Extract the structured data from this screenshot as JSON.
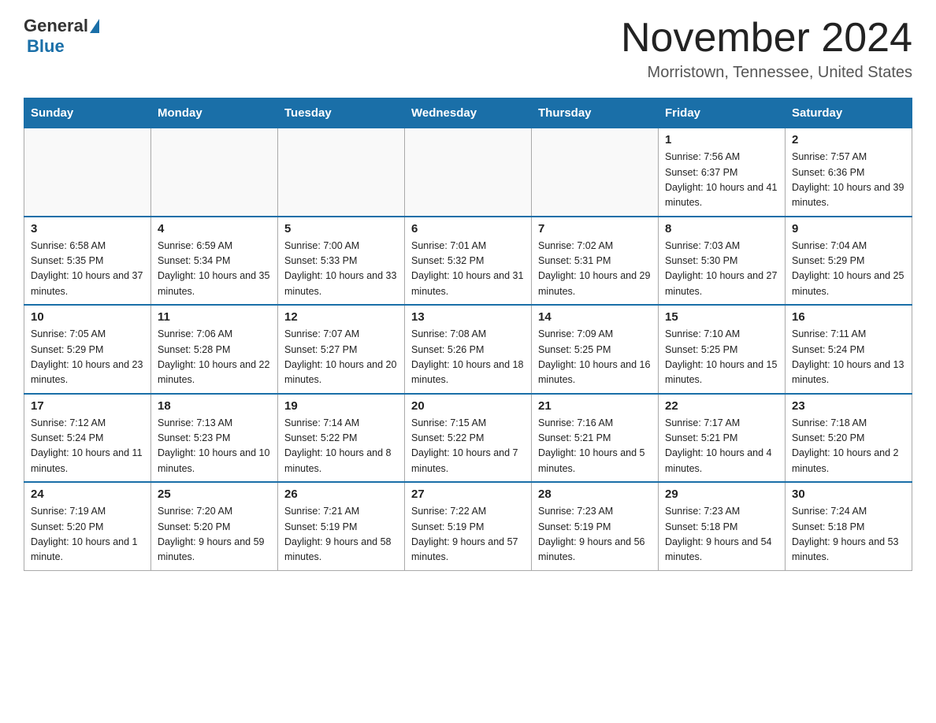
{
  "logo": {
    "general": "General",
    "blue": "Blue"
  },
  "header": {
    "month": "November 2024",
    "location": "Morristown, Tennessee, United States"
  },
  "weekdays": [
    "Sunday",
    "Monday",
    "Tuesday",
    "Wednesday",
    "Thursday",
    "Friday",
    "Saturday"
  ],
  "weeks": [
    [
      {
        "day": "",
        "info": ""
      },
      {
        "day": "",
        "info": ""
      },
      {
        "day": "",
        "info": ""
      },
      {
        "day": "",
        "info": ""
      },
      {
        "day": "",
        "info": ""
      },
      {
        "day": "1",
        "info": "Sunrise: 7:56 AM\nSunset: 6:37 PM\nDaylight: 10 hours and 41 minutes."
      },
      {
        "day": "2",
        "info": "Sunrise: 7:57 AM\nSunset: 6:36 PM\nDaylight: 10 hours and 39 minutes."
      }
    ],
    [
      {
        "day": "3",
        "info": "Sunrise: 6:58 AM\nSunset: 5:35 PM\nDaylight: 10 hours and 37 minutes."
      },
      {
        "day": "4",
        "info": "Sunrise: 6:59 AM\nSunset: 5:34 PM\nDaylight: 10 hours and 35 minutes."
      },
      {
        "day": "5",
        "info": "Sunrise: 7:00 AM\nSunset: 5:33 PM\nDaylight: 10 hours and 33 minutes."
      },
      {
        "day": "6",
        "info": "Sunrise: 7:01 AM\nSunset: 5:32 PM\nDaylight: 10 hours and 31 minutes."
      },
      {
        "day": "7",
        "info": "Sunrise: 7:02 AM\nSunset: 5:31 PM\nDaylight: 10 hours and 29 minutes."
      },
      {
        "day": "8",
        "info": "Sunrise: 7:03 AM\nSunset: 5:30 PM\nDaylight: 10 hours and 27 minutes."
      },
      {
        "day": "9",
        "info": "Sunrise: 7:04 AM\nSunset: 5:29 PM\nDaylight: 10 hours and 25 minutes."
      }
    ],
    [
      {
        "day": "10",
        "info": "Sunrise: 7:05 AM\nSunset: 5:29 PM\nDaylight: 10 hours and 23 minutes."
      },
      {
        "day": "11",
        "info": "Sunrise: 7:06 AM\nSunset: 5:28 PM\nDaylight: 10 hours and 22 minutes."
      },
      {
        "day": "12",
        "info": "Sunrise: 7:07 AM\nSunset: 5:27 PM\nDaylight: 10 hours and 20 minutes."
      },
      {
        "day": "13",
        "info": "Sunrise: 7:08 AM\nSunset: 5:26 PM\nDaylight: 10 hours and 18 minutes."
      },
      {
        "day": "14",
        "info": "Sunrise: 7:09 AM\nSunset: 5:25 PM\nDaylight: 10 hours and 16 minutes."
      },
      {
        "day": "15",
        "info": "Sunrise: 7:10 AM\nSunset: 5:25 PM\nDaylight: 10 hours and 15 minutes."
      },
      {
        "day": "16",
        "info": "Sunrise: 7:11 AM\nSunset: 5:24 PM\nDaylight: 10 hours and 13 minutes."
      }
    ],
    [
      {
        "day": "17",
        "info": "Sunrise: 7:12 AM\nSunset: 5:24 PM\nDaylight: 10 hours and 11 minutes."
      },
      {
        "day": "18",
        "info": "Sunrise: 7:13 AM\nSunset: 5:23 PM\nDaylight: 10 hours and 10 minutes."
      },
      {
        "day": "19",
        "info": "Sunrise: 7:14 AM\nSunset: 5:22 PM\nDaylight: 10 hours and 8 minutes."
      },
      {
        "day": "20",
        "info": "Sunrise: 7:15 AM\nSunset: 5:22 PM\nDaylight: 10 hours and 7 minutes."
      },
      {
        "day": "21",
        "info": "Sunrise: 7:16 AM\nSunset: 5:21 PM\nDaylight: 10 hours and 5 minutes."
      },
      {
        "day": "22",
        "info": "Sunrise: 7:17 AM\nSunset: 5:21 PM\nDaylight: 10 hours and 4 minutes."
      },
      {
        "day": "23",
        "info": "Sunrise: 7:18 AM\nSunset: 5:20 PM\nDaylight: 10 hours and 2 minutes."
      }
    ],
    [
      {
        "day": "24",
        "info": "Sunrise: 7:19 AM\nSunset: 5:20 PM\nDaylight: 10 hours and 1 minute."
      },
      {
        "day": "25",
        "info": "Sunrise: 7:20 AM\nSunset: 5:20 PM\nDaylight: 9 hours and 59 minutes."
      },
      {
        "day": "26",
        "info": "Sunrise: 7:21 AM\nSunset: 5:19 PM\nDaylight: 9 hours and 58 minutes."
      },
      {
        "day": "27",
        "info": "Sunrise: 7:22 AM\nSunset: 5:19 PM\nDaylight: 9 hours and 57 minutes."
      },
      {
        "day": "28",
        "info": "Sunrise: 7:23 AM\nSunset: 5:19 PM\nDaylight: 9 hours and 56 minutes."
      },
      {
        "day": "29",
        "info": "Sunrise: 7:23 AM\nSunset: 5:18 PM\nDaylight: 9 hours and 54 minutes."
      },
      {
        "day": "30",
        "info": "Sunrise: 7:24 AM\nSunset: 5:18 PM\nDaylight: 9 hours and 53 minutes."
      }
    ]
  ]
}
